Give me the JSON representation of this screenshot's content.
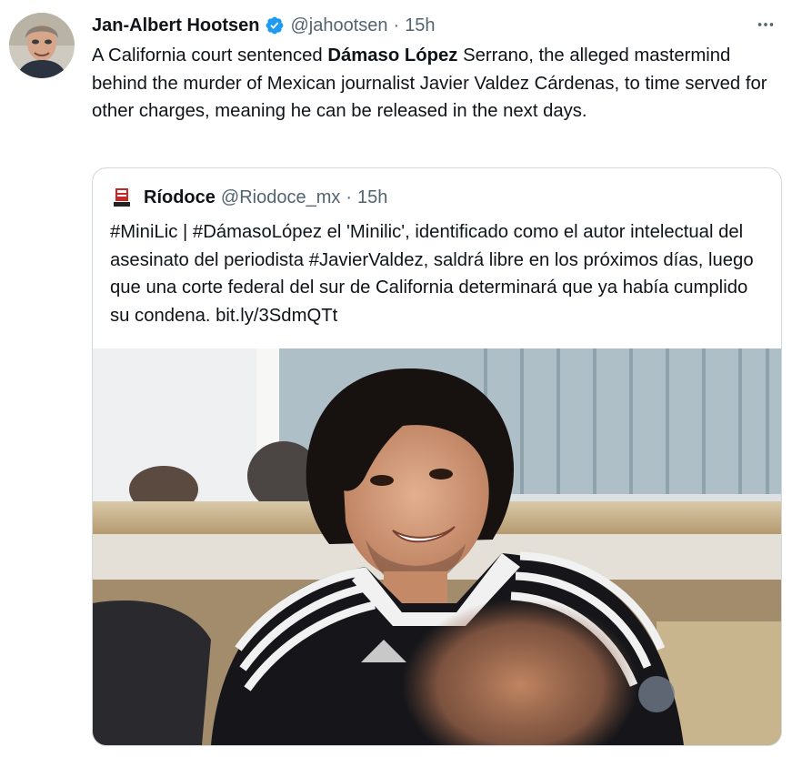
{
  "tweet": {
    "author": {
      "name": "Jan-Albert Hootsen",
      "handle": "@jahootsen",
      "time": "15h",
      "dot": "·"
    },
    "more_icon": "more-horizontal-icon",
    "verified_icon": "verified-badge-icon",
    "text": {
      "part1": "A California court sentenced ",
      "bold": "Dámaso López",
      "part2": " Serrano, the alleged mastermind behind the murder of Mexican journalist Javier Valdez Cárdenas, to time served for other charges, meaning he can be released in the next days."
    }
  },
  "quote": {
    "name": "Ríodoce",
    "handle": "@Riodoce_mx",
    "dot": "·",
    "time": "15h",
    "text": "#MiniLic | #DámasoLópez el 'Minilic', identificado como el autor intelectual del asesinato del periodista #JavierValdez, saldrá libre en los próximos días, luego que una corte federal del sur de California determinará que ya había cumplido su condena. bit.ly/3SdmQTt"
  },
  "colors": {
    "text": "#0f1419",
    "secondary": "#536471",
    "verified": "#1d9bf0",
    "border": "#cfd9de"
  }
}
